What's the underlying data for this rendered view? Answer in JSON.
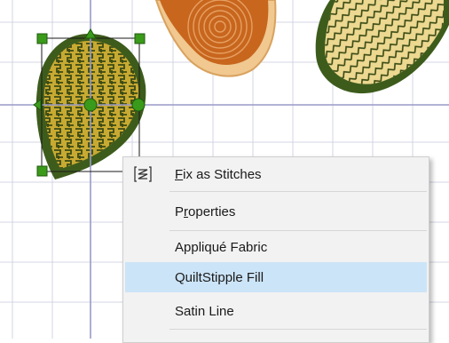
{
  "context_menu": {
    "items": [
      {
        "id": "fix-as-stitches",
        "pre": "",
        "accel": "F",
        "post": "ix as Stitches",
        "icon": "stitches-icon"
      },
      {
        "id": "properties",
        "pre": "P",
        "accel": "r",
        "post": "operties"
      },
      {
        "id": "applique-fabric",
        "pre": "Appliqué Fabric",
        "accel": "",
        "post": ""
      },
      {
        "id": "quiltstipple-fill",
        "pre": "QuiltStipple Fill",
        "accel": "",
        "post": "",
        "highlighted": true
      },
      {
        "id": "satin-line",
        "pre": "Satin Line",
        "accel": "",
        "post": ""
      }
    ]
  },
  "colors": {
    "grid": "#d4d4e4",
    "guide": "#9a9ac8",
    "dark_green": "#3d5c1c",
    "gold": "#c8aa32",
    "handle_green": "#3a9a1a",
    "orange": "#c8661e",
    "tan": "#f0c890",
    "highlight": "#cce4f7"
  }
}
